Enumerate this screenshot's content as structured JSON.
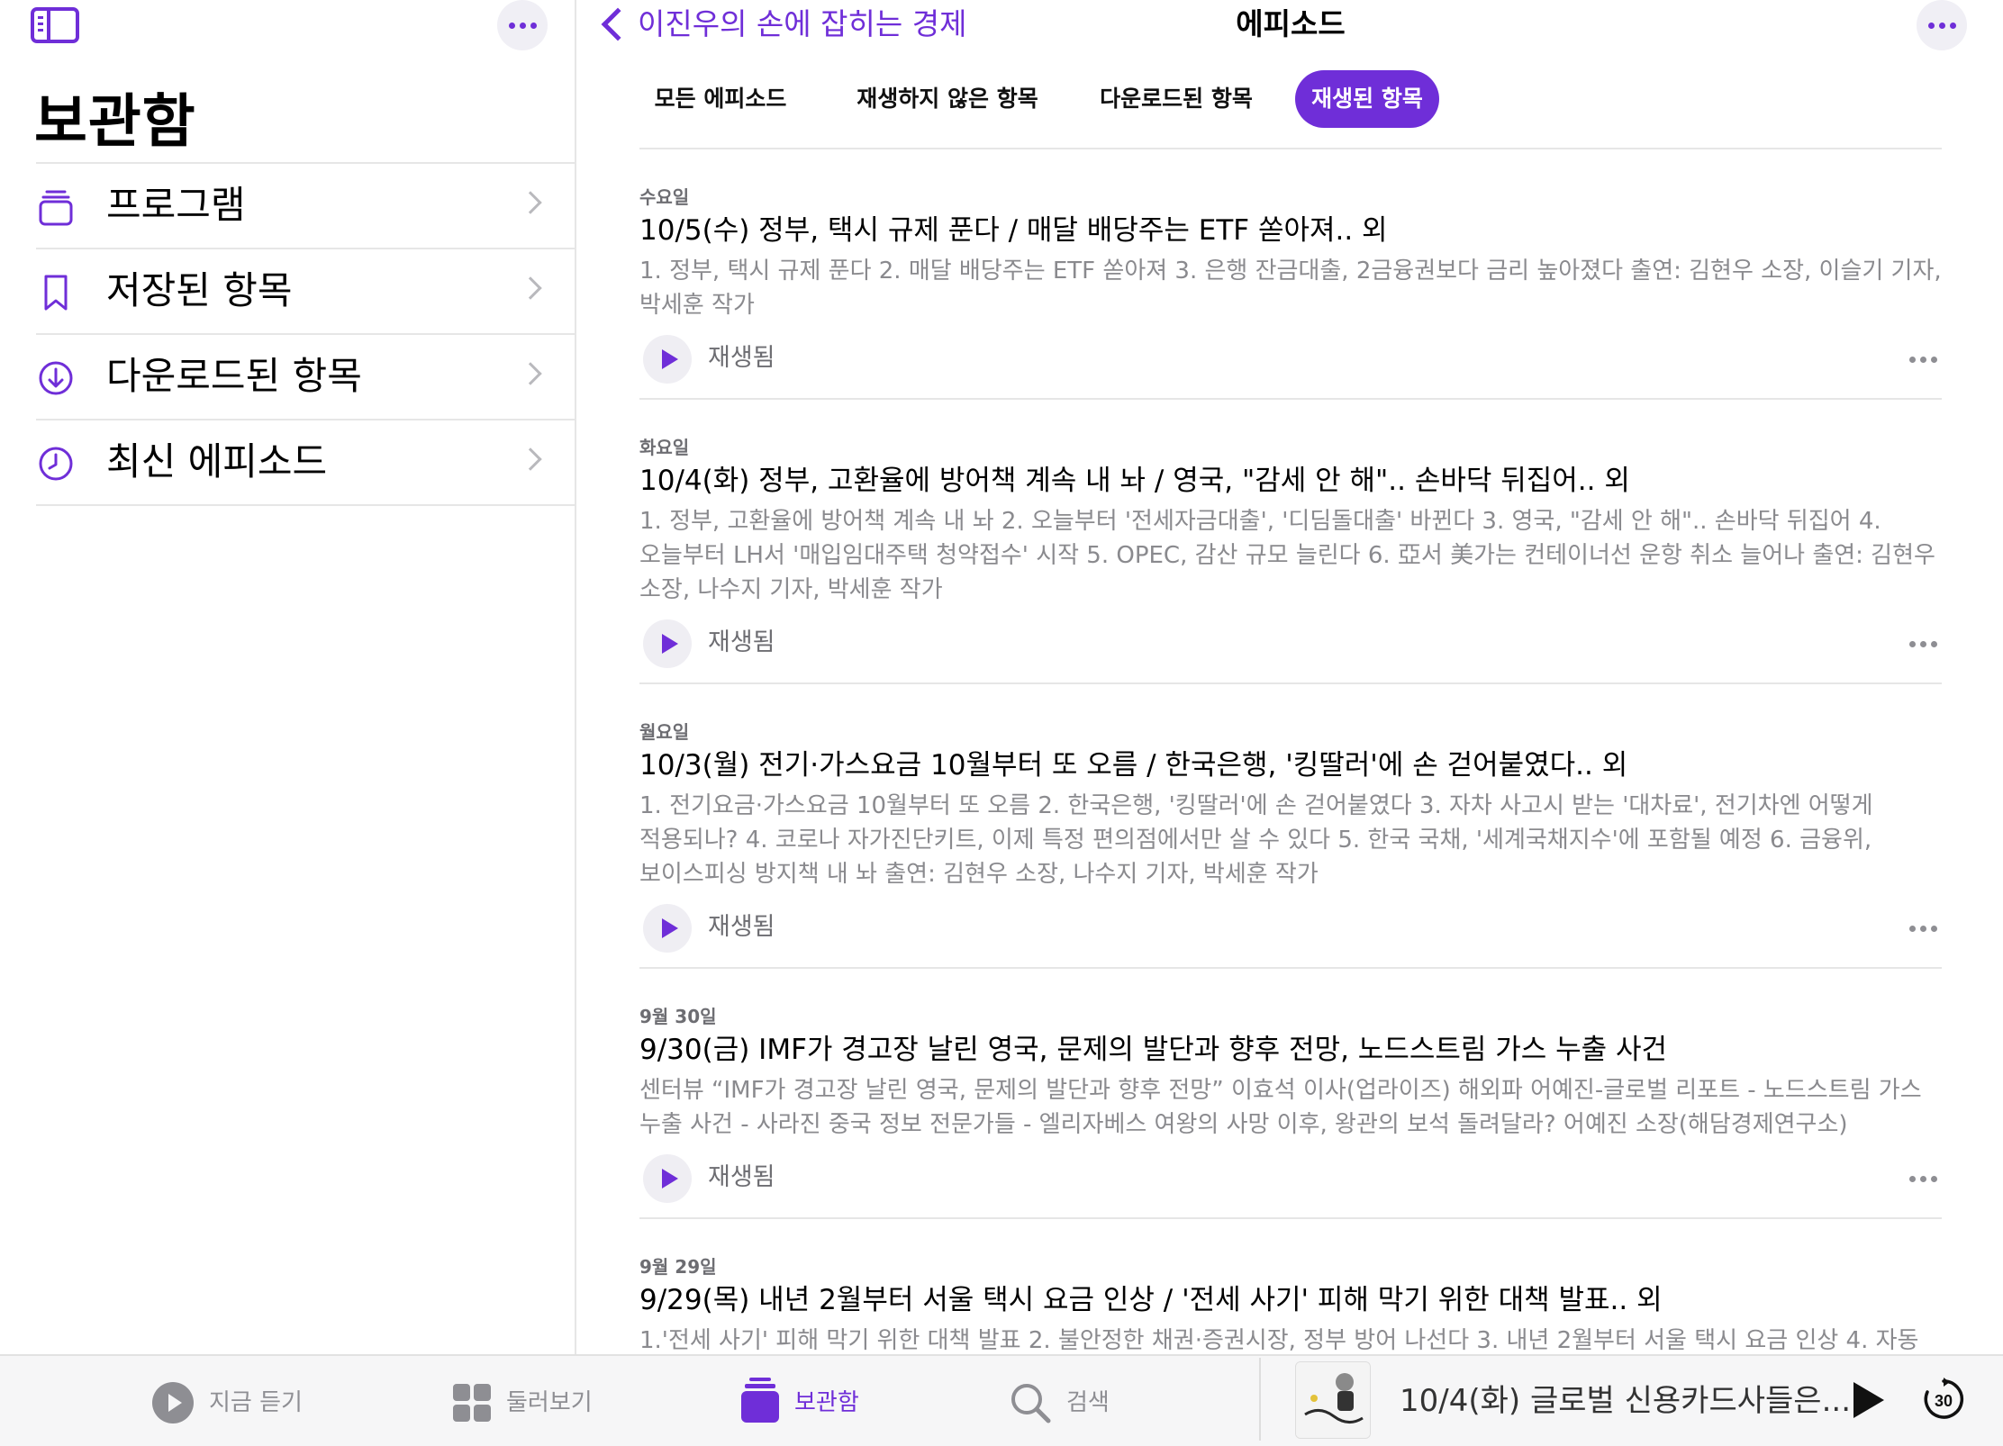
{
  "sidebar": {
    "title": "보관함",
    "items": [
      {
        "label": "프로그램",
        "icon": "stack-icon"
      },
      {
        "label": "저장된 항목",
        "icon": "bookmark-icon"
      },
      {
        "label": "다운로드된 항목",
        "icon": "download-circle-icon"
      },
      {
        "label": "최신 에피소드",
        "icon": "clock-icon"
      }
    ]
  },
  "header": {
    "back_label": "이진우의 손에 잡히는 경제",
    "title": "에피소드"
  },
  "tabs": [
    {
      "label": "모든 에피소드",
      "active": false
    },
    {
      "label": "재생하지 않은 항목",
      "active": false
    },
    {
      "label": "다운로드된 항목",
      "active": false
    },
    {
      "label": "재생된 항목",
      "active": true
    }
  ],
  "episodes": [
    {
      "date": "수요일",
      "title": "10/5(수) 정부, 택시 규제 푼다 / 매달 배당주는 ETF 쏟아져.. 외",
      "description": "1. 정부, 택시 규제 푼다  2. 매달 배당주는 ETF 쏟아져  3. 은행 잔금대출, 2금융권보다 금리 높아졌다  출연: 김현우 소장, 이슬기 기자, 박세훈 작가",
      "status": "재생됨"
    },
    {
      "date": "화요일",
      "title": "10/4(화) 정부, 고환율에 방어책 계속 내 놔 / 영국, \"감세 안 해\".. 손바닥 뒤집어.. 외",
      "description": "1. 정부, 고환율에 방어책 계속 내 놔  2. 오늘부터 '전세자금대출', '디딤돌대출' 바뀐다  3. 영국, \"감세 안 해\".. 손바닥 뒤집어  4. 오늘부터 LH서 '매입임대주택 청약접수' 시작  5. OPEC, 감산 규모 늘린다  6. 亞서 美가는 컨테이너선 운항 취소 늘어나  출연: 김현우 소장, 나수지 기자, 박세훈 작가",
      "status": "재생됨"
    },
    {
      "date": "월요일",
      "title": "10/3(월) 전기·가스요금 10월부터 또 오름 / 한국은행, '킹딸러'에 손 걷어붙였다.. 외",
      "description": "1. 전기요금·가스요금 10월부터 또 오름  2. 한국은행, '킹딸러'에 손 걷어붙였다  3. 자차 사고시 받는 '대차료', 전기차엔 어떻게 적용되나?  4. 코로나 자가진단키트, 이제 특정 편의점에서만 살 수 있다  5. 한국 국채, '세계국채지수'에 포함될 예정  6. 금융위, 보이스피싱 방지책 내 놔  출연: 김현우 소장, 나수지 기자, 박세훈 작가",
      "status": "재생됨"
    },
    {
      "date": "9월 30일",
      "title": "9/30(금) IMF가 경고장 날린 영국, 문제의 발단과 향후 전망, 노드스트림 가스 누출 사건",
      "description": "센터뷰 “IMF가 경고장 날린 영국, 문제의 발단과 향후 전망” 이효석 이사(업라이즈)   해외파 어예진-글로벌 리포트 - 노드스트림 가스 누출 사건 - 사라진 중국 정보 전문가들 - 엘리자베스 여왕의 사망 이후, 왕관의 보석 돌려달라? 어예진 소장(해담경제연구소)",
      "status": "재생됨"
    },
    {
      "date": "9월 29일",
      "title": "9/29(목) 내년 2월부터 서울 택시 요금 인상 / '전세 사기' 피해 막기 위한 대책 발표.. 외",
      "description": "1.'전세 사기' 피해 막기 위한 대책 발표  2. 불안정한 채권·증권시장, 정부 방어 나선다  3. 내년 2월부터 서울 택시 요금 인상  4. 자동",
      "status": ""
    }
  ],
  "tabbar": {
    "items": [
      {
        "label": "지금 듣기",
        "icon": "play-circle-icon",
        "active": false
      },
      {
        "label": "둘러보기",
        "icon": "grid-icon",
        "active": false
      },
      {
        "label": "보관함",
        "icon": "library-stack-icon",
        "active": true
      },
      {
        "label": "검색",
        "icon": "search-icon",
        "active": false
      }
    ]
  },
  "mini_player": {
    "title": "10/4(화) 글로벌 신용카드사들은...",
    "skip_seconds": "30"
  },
  "colors": {
    "accent": "#6f2ed8",
    "secondary_text": "#8a8a8e",
    "divider": "#e6e6e6"
  }
}
